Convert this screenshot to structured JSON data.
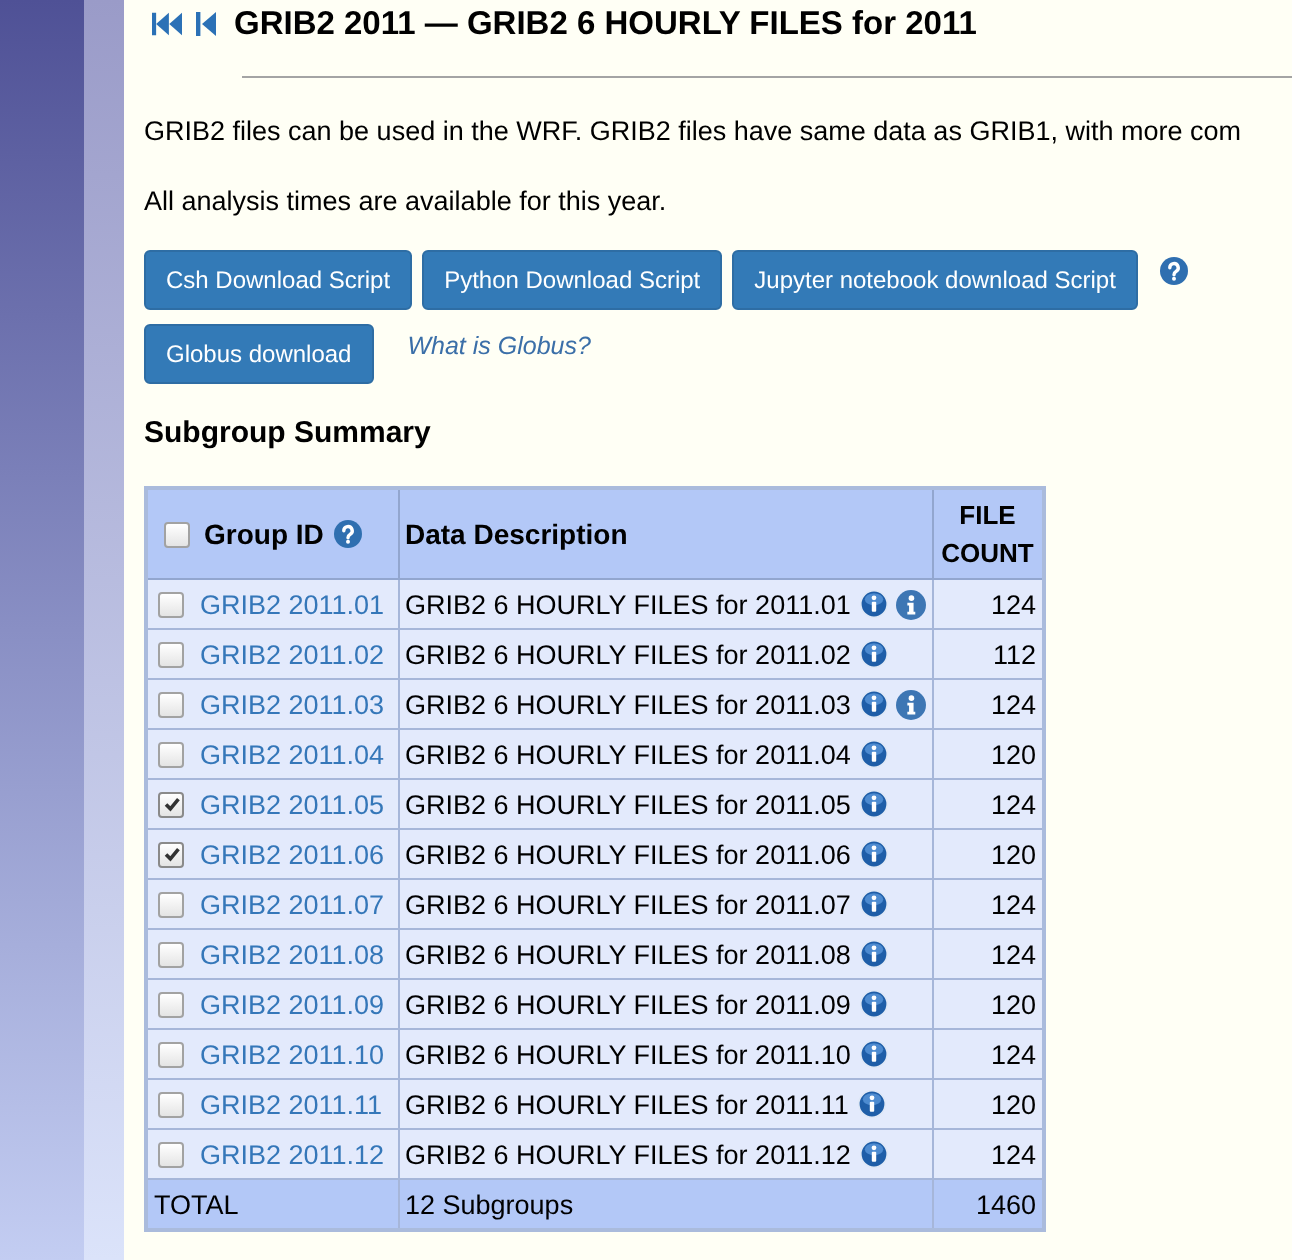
{
  "page": {
    "title": "GRIB2 2011 — GRIB2 6 HOURLY FILES for 2011",
    "paragraphs": [
      "GRIB2 files can be used in the WRF. GRIB2 files have same data as GRIB1, with more com",
      "All analysis times are available for this year."
    ]
  },
  "download_buttons": [
    "Csh Download Script",
    "Python Download Script",
    "Jupyter notebook download Script"
  ],
  "globus": {
    "button": "Globus download",
    "link": "What is Globus?"
  },
  "subgroup_summary": {
    "heading": "Subgroup Summary",
    "columns": [
      "Group ID",
      "Data Description",
      "FILE COUNT"
    ],
    "select_all_checked": false,
    "rows": [
      {
        "checked": false,
        "group_id": "GRIB2 2011.01",
        "description": "GRIB2 6 HOURLY FILES for 2011.01",
        "second_info_icon": true,
        "file_count": "124"
      },
      {
        "checked": false,
        "group_id": "GRIB2 2011.02",
        "description": "GRIB2 6 HOURLY FILES for 2011.02",
        "second_info_icon": false,
        "file_count": "112"
      },
      {
        "checked": false,
        "group_id": "GRIB2 2011.03",
        "description": "GRIB2 6 HOURLY FILES for 2011.03",
        "second_info_icon": true,
        "file_count": "124"
      },
      {
        "checked": false,
        "group_id": "GRIB2 2011.04",
        "description": "GRIB2 6 HOURLY FILES for 2011.04",
        "second_info_icon": false,
        "file_count": "120"
      },
      {
        "checked": true,
        "group_id": "GRIB2 2011.05",
        "description": "GRIB2 6 HOURLY FILES for 2011.05",
        "second_info_icon": false,
        "file_count": "124"
      },
      {
        "checked": true,
        "group_id": "GRIB2 2011.06",
        "description": "GRIB2 6 HOURLY FILES for 2011.06",
        "second_info_icon": false,
        "file_count": "120"
      },
      {
        "checked": false,
        "group_id": "GRIB2 2011.07",
        "description": "GRIB2 6 HOURLY FILES for 2011.07",
        "second_info_icon": false,
        "file_count": "124"
      },
      {
        "checked": false,
        "group_id": "GRIB2 2011.08",
        "description": "GRIB2 6 HOURLY FILES for 2011.08",
        "second_info_icon": false,
        "file_count": "124"
      },
      {
        "checked": false,
        "group_id": "GRIB2 2011.09",
        "description": "GRIB2 6 HOURLY FILES for 2011.09",
        "second_info_icon": false,
        "file_count": "120"
      },
      {
        "checked": false,
        "group_id": "GRIB2 2011.10",
        "description": "GRIB2 6 HOURLY FILES for 2011.10",
        "second_info_icon": false,
        "file_count": "124"
      },
      {
        "checked": false,
        "group_id": "GRIB2 2011.11",
        "description": "GRIB2 6 HOURLY FILES for 2011.11",
        "second_info_icon": false,
        "file_count": "120"
      },
      {
        "checked": false,
        "group_id": "GRIB2 2011.12",
        "description": "GRIB2 6 HOURLY FILES for 2011.12",
        "second_info_icon": false,
        "file_count": "124"
      }
    ],
    "total": {
      "label": "TOTAL",
      "subgroups": "12 Subgroups",
      "file_count": "1460"
    }
  }
}
